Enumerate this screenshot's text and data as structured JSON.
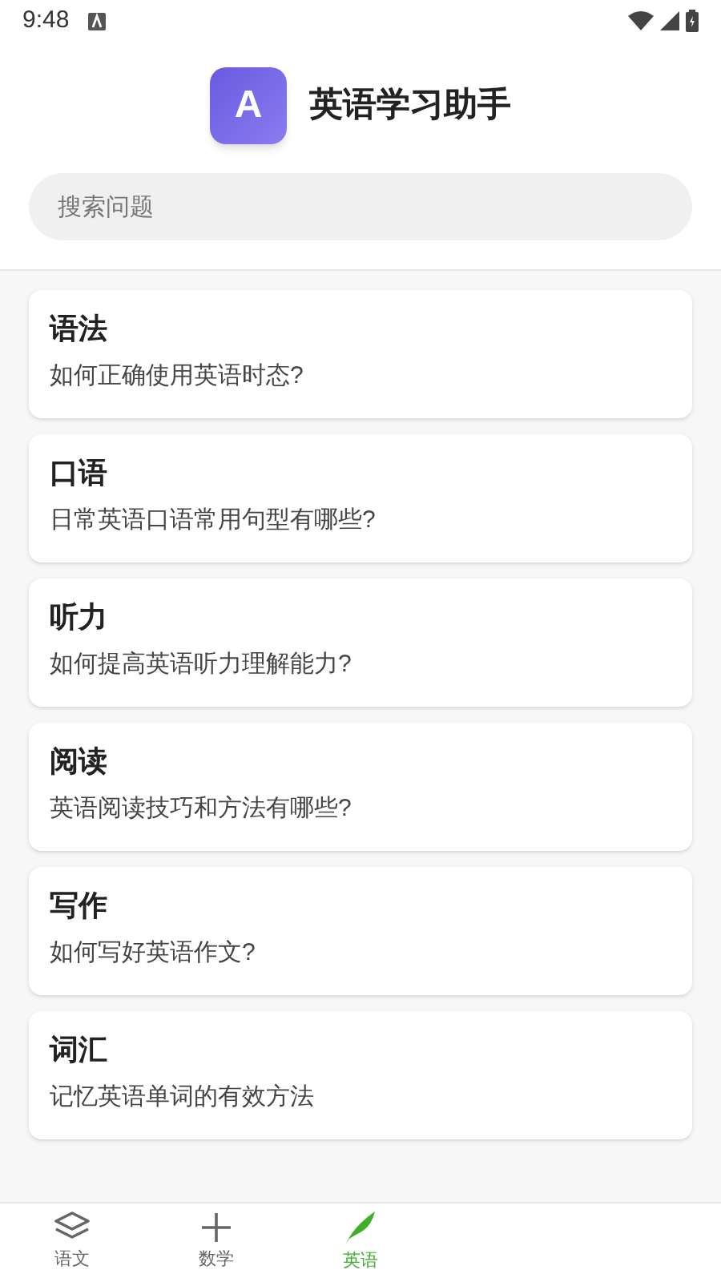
{
  "status_bar": {
    "time": "9:48"
  },
  "header": {
    "logo_letter": "A",
    "title": "英语学习助手"
  },
  "search": {
    "placeholder": "搜索问题"
  },
  "cards": [
    {
      "title": "语法",
      "question": "如何正确使用英语时态?"
    },
    {
      "title": "口语",
      "question": "日常英语口语常用句型有哪些?"
    },
    {
      "title": "听力",
      "question": "如何提高英语听力理解能力?"
    },
    {
      "title": "阅读",
      "question": "英语阅读技巧和方法有哪些?"
    },
    {
      "title": "写作",
      "question": "如何写好英语作文?"
    },
    {
      "title": "词汇",
      "question": "记忆英语单词的有效方法"
    }
  ],
  "bottom_nav": [
    {
      "kind": "layers",
      "label": "语文",
      "selected": false
    },
    {
      "kind": "plus",
      "label": "数学",
      "selected": false
    },
    {
      "kind": "feather",
      "label": "英语",
      "selected": true
    }
  ]
}
